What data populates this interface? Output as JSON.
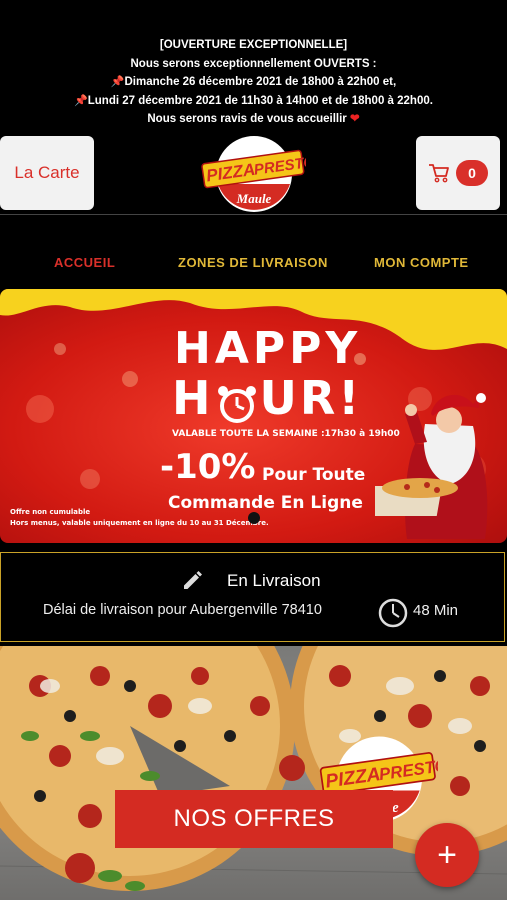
{
  "announcement": {
    "line1": "[OUVERTURE EXCEPTIONNELLE]",
    "line2": "Nous serons exceptionnellement OUVERTS :",
    "line3": "Dimanche 26 décembre 2021 de 18h00 à 22h00 et,",
    "line4": "Lundi 27 décembre 2021 de 11h30 à 14h00 et de 18h00 à 22h00.",
    "line5": "Nous serons ravis de vous accueillir",
    "pin_icon": "pushpin-icon",
    "heart_icon": "heart-icon"
  },
  "header": {
    "menu_button": "La Carte",
    "logo": {
      "word1": "PIZZA",
      "word2": "PRESTO",
      "town": "Maule"
    },
    "cart_count": "0",
    "cart_icon": "cart-icon"
  },
  "nav": [
    {
      "label": "ACCUEIL",
      "color": "#d9302a"
    },
    {
      "label": "ZONES DE LIVRAISON",
      "color": "#e0b838"
    },
    {
      "label": "MON COMPTE",
      "color": "#e0b838"
    }
  ],
  "banner": {
    "title1": "HAPPY",
    "title2a": "H",
    "title2b": "UR!",
    "validity": "VALABLE TOUTE LA SEMAINE :17h30 à 19h00",
    "discount": "-10%",
    "offer1": "Pour Toute",
    "offer2": "Commande En Ligne",
    "note1": "Offre non cumulable",
    "note2": "Hors menus, valable uniquement en ligne du 10 au 31 Décembre."
  },
  "delivery": {
    "mode": "En Livraison",
    "delay_text": "Délai de livraison pour Aubergenville 78410",
    "time": "48 Min",
    "edit_icon": "pencil-icon",
    "clock_icon": "clock-icon"
  },
  "promo": {
    "button": "NOS OFFRES",
    "fab": "+",
    "logo": {
      "word1": "PIZZA",
      "word2": "PRESTO",
      "town": "Maule"
    }
  },
  "colors": {
    "accent": "#d42b22",
    "gold": "#c9a227",
    "yellow": "#f7d21e"
  }
}
